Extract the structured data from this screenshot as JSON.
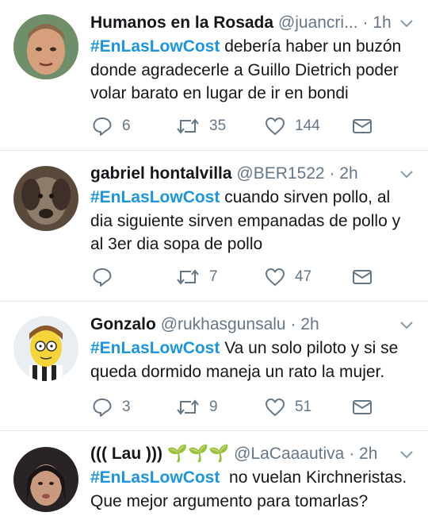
{
  "tweets": [
    {
      "name": "Humanos en la Rosada",
      "handle": "@juancri...",
      "time": "· 1h",
      "hashtag": "#EnLasLowCost",
      "text": " debería haber un buzón donde agradecerle a Guillo Dietrich poder volar barato en lugar de ir en bondi",
      "replies": "6",
      "retweets": "35",
      "likes": "144"
    },
    {
      "name": "gabriel hontalvilla",
      "handle": "@BER1522",
      "time": "· 2h",
      "hashtag": "#EnLasLowCost",
      "text": " cuando sirven pollo, al dia siguiente sirven empanadas de pollo y al 3er dia sopa de pollo",
      "replies": "",
      "retweets": "7",
      "likes": "47"
    },
    {
      "name": "Gonzalo",
      "handle": "@rukhasgunsalu",
      "time": "· 2h",
      "hashtag": "#EnLasLowCost",
      "text": " Va un solo piloto y si se queda dormido maneja un rato la mujer.",
      "replies": "3",
      "retweets": "9",
      "likes": "51"
    },
    {
      "name": "((( Lau )))",
      "name_emoji": "🌱🌱🌱",
      "handle": "@LaCaaautiva",
      "time": "· 2h",
      "hashtag": "#EnLasLowCost",
      "text": "  no vuelan Kirchneristas. Que mejor argumento para tomarlas?",
      "replies": "",
      "retweets": "",
      "likes": ""
    }
  ],
  "icons": {
    "reply": "reply-icon",
    "retweet": "retweet-icon",
    "like": "heart-icon",
    "dm": "envelope-icon",
    "more": "chevron-down-icon"
  },
  "colors": {
    "hashtag": "#1b95e0",
    "secondary": "#657786",
    "divider": "#e1e8ed"
  }
}
